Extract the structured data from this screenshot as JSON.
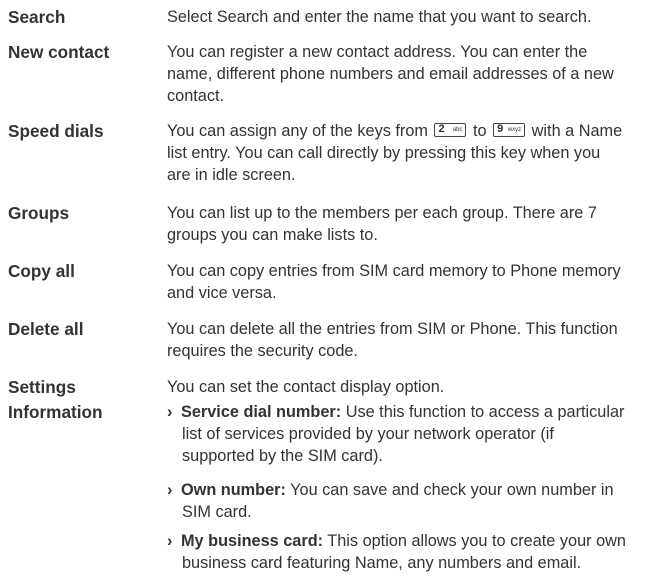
{
  "entries": [
    {
      "term": "Search",
      "lines": [
        "Select Search and enter the name that you want to search."
      ]
    },
    {
      "term": "New contact",
      "lines": [
        "You can register a new contact address. You can enter the",
        "name, different phone numbers and email addresses of a new",
        "contact."
      ]
    },
    {
      "term": "Speed dials",
      "line1_before": "You can assign any of the keys from",
      "line1_mid": "to",
      "line1_after": "with a Name",
      "key_from": {
        "digit": "2",
        "letters": "abc"
      },
      "key_to": {
        "digit": "9",
        "letters": "wxyz"
      },
      "lines": [
        "list entry. You can call directly by pressing this key when you",
        "are in idle screen."
      ]
    },
    {
      "term": "Groups",
      "lines": [
        "You can list up to the members per each group. There are 7",
        "groups you can make lists to."
      ]
    },
    {
      "term": "Copy all",
      "lines": [
        "You can copy entries from SIM card memory to Phone memory",
        "and vice versa."
      ]
    },
    {
      "term": "Delete all",
      "lines": [
        "You can delete all the entries from SIM or Phone. This function",
        "requires the security code."
      ]
    },
    {
      "term": "Settings",
      "lines": [
        "You can set the contact display option."
      ]
    },
    {
      "term": "Information",
      "bullets": [
        {
          "marker": "›",
          "label": "Service dial number:",
          "first": " Use this function to access a particular",
          "rest": [
            "list of services provided by your network operator (if",
            "supported by the SIM card)."
          ]
        },
        {
          "marker": "›",
          "label": "Own number:",
          "first": " You can save and check your own number in",
          "rest": [
            "SIM card."
          ]
        },
        {
          "marker": "›",
          "label": "My business card:",
          "first": " This option allows you to create your own",
          "rest": [
            "business card featuring Name, any numbers and email."
          ]
        }
      ]
    }
  ]
}
